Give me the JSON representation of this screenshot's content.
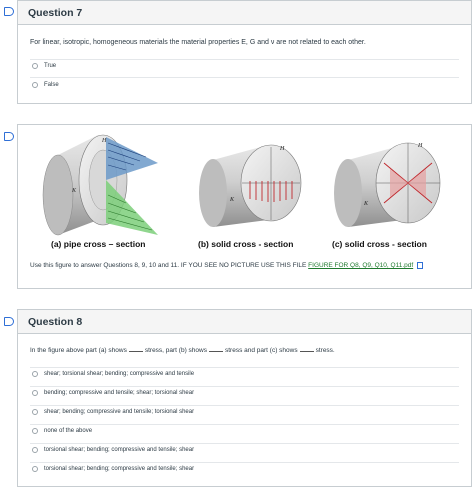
{
  "q7": {
    "title": "Question 7",
    "text": "For linear, isotropic, homogeneous materials the material properties E, G and ν are not related to each other.",
    "options": [
      "True",
      "False"
    ]
  },
  "figure": {
    "label_a": "(a) pipe cross – section",
    "label_b": "(b) solid cross - section",
    "label_c": "(c) solid cross - section",
    "h_label": "H",
    "k_label": "K",
    "caption": "Use this figure to answer Questions 8, 9, 10 and 11. IF YOU SEE NO PICTURE USE THIS FILE ",
    "link": "FIGURE FOR Q8, Q9, Q10, Q11.pdf"
  },
  "q8": {
    "title": "Question 8",
    "text_1": "In the figure above part (a) shows",
    "text_2": "stress, part (b) shows",
    "text_3": "stress and part (c) shows",
    "text_4": "stress.",
    "options": [
      "shear; torsional shear; bending; compressive and tensile",
      "bending; compressive and tensile; shear; torsional shear",
      "shear; bending; compressive and tensile; torsional shear",
      "none of the above",
      "torsional shear; bending; compressive and tensile; shear",
      "torsional shear; bending; compressive and tensile; shear"
    ]
  },
  "colors": {
    "accent": "#2f6fd6",
    "link": "#1f7a2e",
    "arrow": "#c0282d"
  }
}
